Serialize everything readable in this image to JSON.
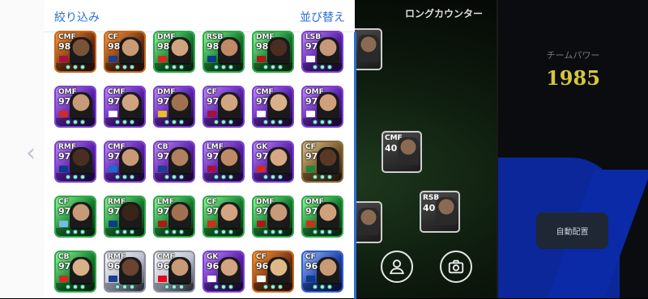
{
  "panel": {
    "filter_label": "絞り込み",
    "sort_label": "並び替え"
  },
  "field": {
    "long_counter": "ロングカウンター",
    "team_power_label": "チームパワー",
    "team_power_value": "1985",
    "auto_assign_label": "自動配置",
    "cards": [
      {
        "pos": "",
        "rating": ""
      },
      {
        "pos": "CMF",
        "rating": "40"
      },
      {
        "pos": "RSB",
        "rating": "40"
      },
      {
        "pos": "",
        "rating": ""
      }
    ]
  },
  "icons": {
    "profile": "person-icon",
    "screenshot": "camera-icon",
    "back": "chevron-left-icon"
  },
  "cards": [
    {
      "pos": "CMF",
      "rating": "98",
      "frame": "orange",
      "flag": "#a4123a",
      "face": "#7a5236"
    },
    {
      "pos": "CF",
      "rating": "98",
      "frame": "orange",
      "flag": "#1d3f8f",
      "face": "#c99a74"
    },
    {
      "pos": "DMF",
      "rating": "98",
      "frame": "green",
      "flag": "#d52b1e",
      "face": "#d0a47e"
    },
    {
      "pos": "RSB",
      "rating": "98",
      "frame": "green",
      "flag": "#0b3b8a",
      "face": "#c08a66"
    },
    {
      "pos": "DMF",
      "rating": "98",
      "frame": "green",
      "flag": "#b01818",
      "face": "#4a2e22"
    },
    {
      "pos": "LSB",
      "rating": "97",
      "frame": "purple",
      "flag": "#ffffff",
      "face": "#c8987a"
    },
    {
      "pos": "OMF",
      "rating": "97",
      "frame": "purple",
      "flag": "#d52b1e",
      "face": "#c89a78"
    },
    {
      "pos": "CMF",
      "rating": "97",
      "frame": "purple",
      "flag": "#ffffff",
      "face": "#d0a482"
    },
    {
      "pos": "DMF",
      "rating": "97",
      "frame": "purple",
      "flag": "#e8c020",
      "face": "#a07050"
    },
    {
      "pos": "CF",
      "rating": "97",
      "frame": "purple",
      "flag": "#a4123a",
      "face": "#d2a482"
    },
    {
      "pos": "CMF",
      "rating": "97",
      "frame": "purple",
      "flag": "#ffffff",
      "face": "#d8b08a"
    },
    {
      "pos": "OMF",
      "rating": "97",
      "frame": "purple",
      "flag": "#ffffff",
      "face": "#d0a07a"
    },
    {
      "pos": "RMF",
      "rating": "97",
      "frame": "purple",
      "flag": "#0b3b8a",
      "face": "#4a2e22"
    },
    {
      "pos": "CMF",
      "rating": "97",
      "frame": "purple",
      "flag": "#1a6ad0",
      "face": "#c89a78"
    },
    {
      "pos": "CB",
      "rating": "97",
      "frame": "purple",
      "flag": "#1d3f8f",
      "face": "#b08060"
    },
    {
      "pos": "LMF",
      "rating": "97",
      "frame": "purple",
      "flag": "#a4123a",
      "face": "#c08a66"
    },
    {
      "pos": "GK",
      "rating": "97",
      "frame": "purple",
      "flag": "#d52b1e",
      "face": "#d6a884"
    },
    {
      "pos": "CF",
      "rating": "97",
      "frame": "brown",
      "flag": "#1a8a3a",
      "face": "#5a3826"
    },
    {
      "pos": "CF",
      "rating": "97",
      "frame": "green",
      "flag": "#7ab8e8",
      "face": "#c89a78"
    },
    {
      "pos": "RMF",
      "rating": "97",
      "frame": "green",
      "flag": "#0b3b8a",
      "face": "#3a2418"
    },
    {
      "pos": "LMF",
      "rating": "97",
      "frame": "green",
      "flag": "#b01818",
      "face": "#a07050"
    },
    {
      "pos": "CF",
      "rating": "97",
      "frame": "green",
      "flag": "#d52b1e",
      "face": "#d2a482"
    },
    {
      "pos": "DMF",
      "rating": "97",
      "frame": "green",
      "flag": "#b01818",
      "face": "#c89a78"
    },
    {
      "pos": "OMF",
      "rating": "97",
      "frame": "green",
      "flag": "#d52b1e",
      "face": "#d0a07a"
    },
    {
      "pos": "CB",
      "rating": "97",
      "frame": "green",
      "flag": "#d52b1e",
      "face": "#d8b08a"
    },
    {
      "pos": "RMF",
      "rating": "96",
      "frame": "white",
      "flag": "#1d3f8f",
      "face": "#6a4430"
    },
    {
      "pos": "CMF",
      "rating": "96",
      "frame": "white",
      "flag": "#e30a17",
      "face": "#c89a78"
    },
    {
      "pos": "GK",
      "rating": "96",
      "frame": "purple",
      "flag": "#ffffff",
      "face": "#d2a482"
    },
    {
      "pos": "CF",
      "rating": "96",
      "frame": "orange",
      "flag": "#ffffff",
      "face": "#e0b888"
    },
    {
      "pos": "CF",
      "rating": "96",
      "frame": "blue",
      "flag": "#0b3b8a",
      "face": "#c89a78"
    }
  ]
}
